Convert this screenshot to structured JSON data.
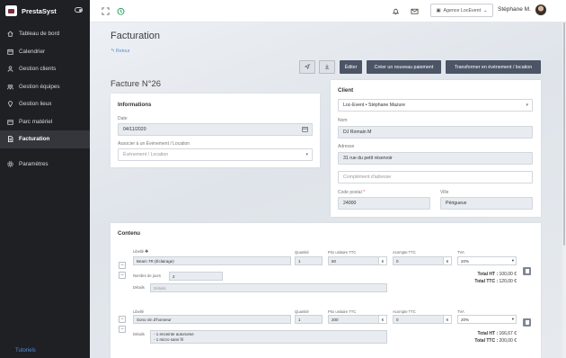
{
  "sidebar": {
    "brand": "PrestaSyst",
    "items": [
      {
        "label": "Tableau de bord",
        "icon": "home-icon"
      },
      {
        "label": "Calendrier",
        "icon": "calendar-icon"
      },
      {
        "label": "Gestion clients",
        "icon": "user-icon"
      },
      {
        "label": "Gestion équipes",
        "icon": "team-icon"
      },
      {
        "label": "Gestion lieux",
        "icon": "location-icon"
      },
      {
        "label": "Parc matériel",
        "icon": "box-icon"
      },
      {
        "label": "Facturation",
        "icon": "invoice-icon",
        "active": true
      },
      {
        "label": "Paramètres",
        "icon": "gear-icon"
      }
    ],
    "tutorials": "Tutoriels"
  },
  "topbar": {
    "agency": "Agence LocEvent",
    "user": "Stéphane M."
  },
  "page": {
    "title": "Facturation",
    "back": "Retour",
    "buttons": {
      "edit": "Éditer",
      "new_payment": "Créer un nouveau paiement",
      "transform": "Transformer en événement / location"
    },
    "invoice_title": "Facture N°26"
  },
  "info": {
    "title": "Informations",
    "date_label": "Date",
    "date_value": "04/11/2020",
    "assoc_label": "Associer à un Événement / Location",
    "assoc_placeholder": "Événement / Location"
  },
  "client": {
    "title": "Client",
    "select_value": "Loc-Event • Stéphane Mazure",
    "name_label": "Nom",
    "name_value": "DJ Romain M",
    "address_label": "Adresse",
    "address_value": "31 rue du petit réservoir",
    "address2_placeholder": "Complément d'adresse",
    "postal_label": "Code postal",
    "postal_value": "24000",
    "city_label": "Ville",
    "city_value": "Périgueux"
  },
  "content": {
    "title": "Contenu",
    "headers": {
      "label": "Libellé",
      "qty": "Quantité",
      "unit_price": "Prix unitaire TTC",
      "deposit": "Acompte TTC",
      "vat": "TVA",
      "days": "Nombre de jours",
      "details": "Détails"
    },
    "currency": "€",
    "lines": [
      {
        "label": "Beam 7R (Éclairage)",
        "qty": "1",
        "unit_price": "60",
        "deposit": "0",
        "vat": "20%",
        "days": "2",
        "details_placeholder": "Détails",
        "total_ht_label": "Total HT :",
        "total_ht": "100,00 €",
        "total_ttc_label": "Total TTC :",
        "total_ttc": "120,00 €"
      },
      {
        "label": "Sono vin d'honneur",
        "qty": "1",
        "unit_price": "200",
        "deposit": "0",
        "vat": "20%",
        "details_lines": [
          "- 1 enceinte autonome",
          "- 1 micro sans fil"
        ],
        "total_ht_label": "Total HT :",
        "total_ht": "166,67 €",
        "total_ttc_label": "Total TTC :",
        "total_ttc": "200,00 €"
      }
    ]
  }
}
